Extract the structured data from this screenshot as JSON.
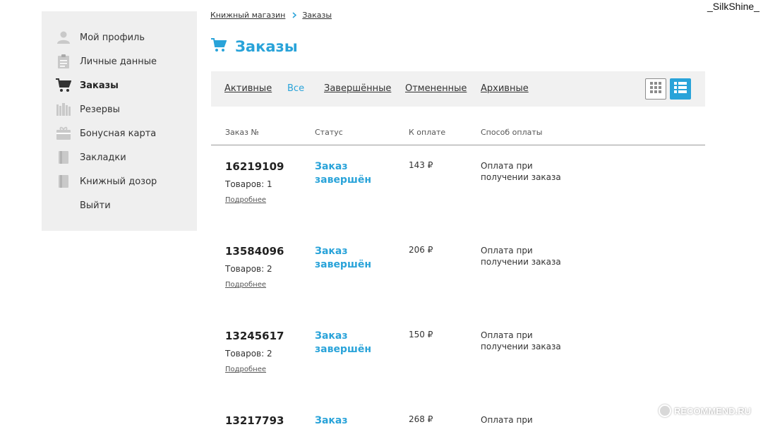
{
  "watermark": {
    "user": "_SilkShine_",
    "site": "RECOMMEND.RU"
  },
  "colors": {
    "accent": "#29a3d9",
    "sidebar_bg": "#efefef",
    "filter_bg": "#f1f1f1"
  },
  "sidebar": {
    "items": [
      {
        "label": "Мой профиль",
        "icon": "user-icon"
      },
      {
        "label": "Личные данные",
        "icon": "clipboard-icon"
      },
      {
        "label": "Заказы",
        "icon": "cart-icon",
        "active": true
      },
      {
        "label": "Резервы",
        "icon": "books-icon"
      },
      {
        "label": "Бонусная карта",
        "icon": "gift-card-icon"
      },
      {
        "label": "Закладки",
        "icon": "bookmark-icon"
      },
      {
        "label": "Книжный дозор",
        "icon": "book-watch-icon"
      },
      {
        "label": "Выйти"
      }
    ]
  },
  "breadcrumb": {
    "items": [
      "Книжный магазин",
      "Заказы"
    ],
    "separator_icon": "chevron-right-icon"
  },
  "page": {
    "title": "Заказы",
    "title_icon": "cart-icon"
  },
  "filters": {
    "tabs": [
      "Активные",
      "Все",
      "Завершённые",
      "Отмененные",
      "Архивные"
    ],
    "active": "Все",
    "view_modes": [
      "grid-view-icon",
      "list-view-icon"
    ],
    "active_view": "list-view-icon"
  },
  "table": {
    "headers": [
      "Заказ №",
      "Статус",
      "К оплате",
      "Способ оплаты"
    ],
    "more_label": "Подробнее",
    "rows": [
      {
        "number": "16219109",
        "count": "Товаров: 1",
        "status": "Заказ завершён",
        "sum": "143 ₽",
        "payment": "Оплата при получении заказа"
      },
      {
        "number": "13584096",
        "count": "Товаров: 2",
        "status": "Заказ завершён",
        "sum": "206 ₽",
        "payment": "Оплата при получении заказа"
      },
      {
        "number": "13245617",
        "count": "Товаров: 2",
        "status": "Заказ завершён",
        "sum": "150 ₽",
        "payment": "Оплата при получении заказа"
      },
      {
        "number": "13217793",
        "count": "",
        "status": "Заказ",
        "sum": "268 ₽",
        "payment": "Оплата при"
      }
    ]
  }
}
